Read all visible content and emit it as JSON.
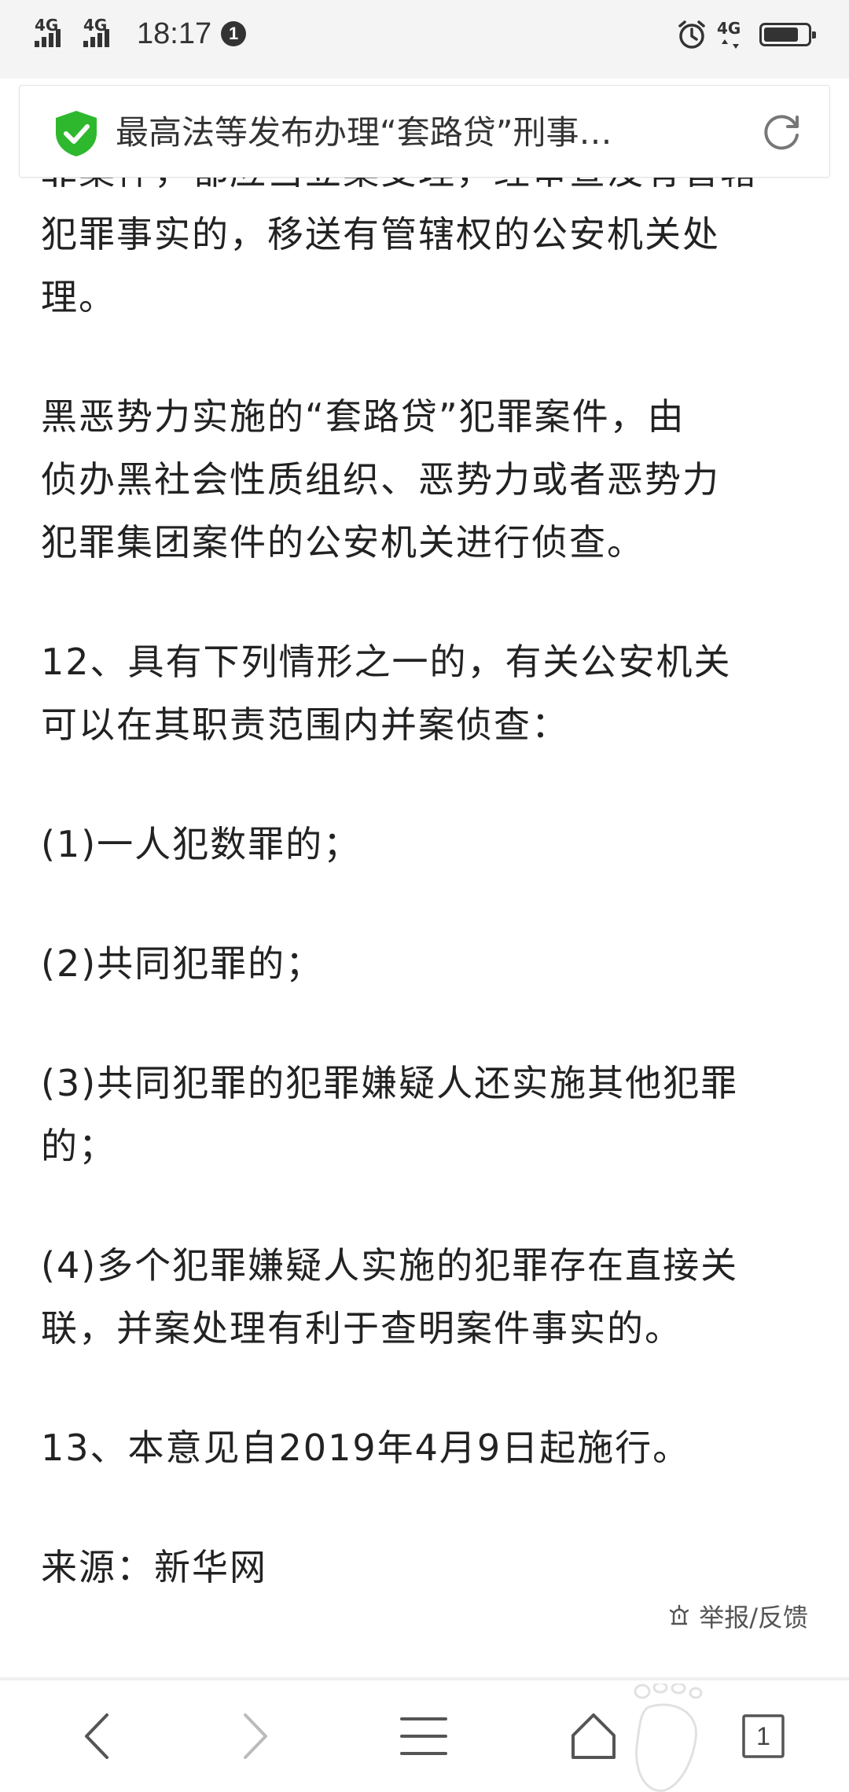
{
  "status_bar": {
    "network_1": "4G",
    "network_2": "4G",
    "time": "18:17",
    "notification_count": "1",
    "network_right": "4G",
    "battery_level": 0.8
  },
  "address_bar": {
    "page_title": "最高法等发布办理“套路贷”刑事…"
  },
  "article": {
    "cut_line": "罪案件，都应当立案受理，经审查没有管辖",
    "para1_line2": "犯罪事实的，移送有管辖权的公安机关处",
    "para1_line3": "理。",
    "para2_line1": "黑恶势力实施的“套路贷”犯罪案件，由",
    "para2_line2": "侦办黑社会性质组织、恶势力或者恶势力",
    "para2_line3": "犯罪集团案件的公安机关进行侦查。",
    "para3_line1": "12、具有下列情形之一的，有关公安机关",
    "para3_line2": "可以在其职责范围内并案侦查：",
    "item1": "(1)一人犯数罪的；",
    "item2": "(2)共同犯罪的；",
    "item3_line1": "(3)共同犯罪的犯罪嫌疑人还实施其他犯罪",
    "item3_line2": "的；",
    "item4_line1": "(4)多个犯罪嫌疑人实施的犯罪存在直接关",
    "item4_line2": "联，并案处理有利于查明案件事实的。",
    "para4": "13、本意见自2019年4月9日起施行。",
    "source": "来源：新华网",
    "report_label": "举报/反馈"
  },
  "toolbar": {
    "tab_count": "1"
  },
  "colors": {
    "shield_green": "#2eb82e",
    "text": "#222222",
    "status_bg": "#f4f4f4"
  }
}
